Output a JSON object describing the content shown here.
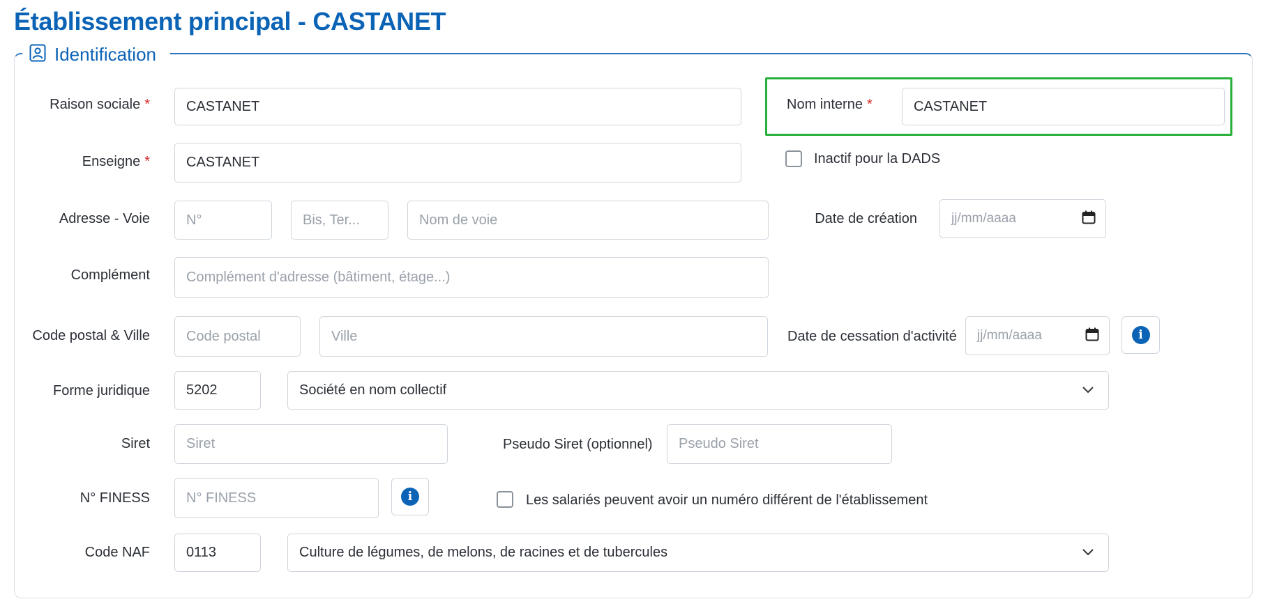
{
  "page": {
    "title": "Établissement principal - CASTANET"
  },
  "section": {
    "title": "Identification",
    "icon": "user-badge-icon"
  },
  "required_mark": "*",
  "fields": {
    "raison_sociale": {
      "label": "Raison sociale",
      "value": "CASTANET"
    },
    "nom_interne": {
      "label": "Nom interne",
      "value": "CASTANET"
    },
    "enseigne": {
      "label": "Enseigne",
      "value": "CASTANET"
    },
    "inactif_dads": {
      "label": "Inactif pour la DADS",
      "checked": false
    },
    "adresse": {
      "label": "Adresse - Voie",
      "numero_placeholder": "N°",
      "bis_placeholder": "Bis, Ter...",
      "voie_placeholder": "Nom de voie"
    },
    "date_creation": {
      "label": "Date de création",
      "placeholder": "jj/mm/aaaa"
    },
    "complement": {
      "label": "Complément",
      "placeholder": "Complément d'adresse (bâtiment, étage...)"
    },
    "code_postal_ville": {
      "label": "Code postal & Ville",
      "cp_placeholder": "Code postal",
      "ville_placeholder": "Ville"
    },
    "date_cessation": {
      "label": "Date de cessation d'activité",
      "placeholder": "jj/mm/aaaa"
    },
    "forme_juridique": {
      "label": "Forme juridique",
      "code": "5202",
      "selected": "Société en nom collectif"
    },
    "siret": {
      "label": "Siret",
      "placeholder": "Siret"
    },
    "pseudo_siret": {
      "label": "Pseudo Siret (optionnel)",
      "placeholder": "Pseudo Siret"
    },
    "finess": {
      "label": "N° FINESS",
      "placeholder": "N° FINESS"
    },
    "salaries_numero": {
      "label": "Les salariés peuvent avoir un numéro différent de l'établissement",
      "checked": false
    },
    "code_naf": {
      "label": "Code NAF",
      "code": "0113",
      "selected": "Culture de légumes, de melons, de racines et de tubercules"
    }
  },
  "colors": {
    "accent": "#0b63b6",
    "required": "#d32f2f",
    "highlight": "#27b03a"
  }
}
